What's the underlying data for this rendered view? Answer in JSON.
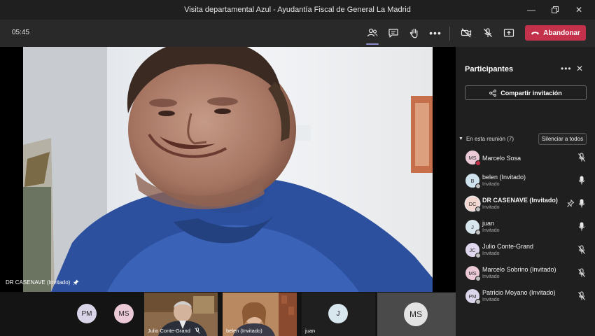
{
  "window": {
    "title": "Visita departamental Azul - Ayudantía Fiscal de General La Madrid"
  },
  "toolbar": {
    "timer": "05:45",
    "leave_label": "Abandonar"
  },
  "stage": {
    "speaker_name": "DR CASENAVE (Invitado)"
  },
  "strip": {
    "avatars": [
      {
        "initials": "PM",
        "color": "#d9d4e8"
      },
      {
        "initials": "MS",
        "color": "#ecc9d6"
      }
    ],
    "tiles": [
      {
        "label": "Julio Conte-Grand"
      },
      {
        "label": "belen (Invitado)"
      },
      {
        "label": "juan",
        "initials": "J"
      },
      {
        "initials": "MS"
      }
    ]
  },
  "panel": {
    "title": "Participantes",
    "share_label": "Compartir invitación",
    "section_label": "En esta reunión (7)",
    "mute_all_label": "Silenciar a todos",
    "participants": [
      {
        "initials": "MS",
        "name": "Marcelo Sosa",
        "role": "",
        "avatar_color": "#ecc9d6",
        "status_color": "#c4314b",
        "mic": "muted",
        "bold": false
      },
      {
        "initials": "B",
        "name": "belen (Invitado)",
        "role": "Invitado",
        "avatar_color": "#cfe3ef",
        "status_color": "#bdbdbd",
        "mic": "on",
        "bold": false
      },
      {
        "initials": "DC",
        "name": "DR CASENAVE (Invitado)",
        "role": "Invitado",
        "avatar_color": "#f3d6d0",
        "status_color": "#bdbdbd",
        "mic": "on",
        "bold": true,
        "pinned": true
      },
      {
        "initials": "J",
        "name": "juan",
        "role": "Invitado",
        "avatar_color": "#d8e6ee",
        "status_color": "#bdbdbd",
        "mic": "on",
        "bold": false
      },
      {
        "initials": "JC",
        "name": "Julio Conte-Grand",
        "role": "Invitado",
        "avatar_color": "#e0d8ef",
        "status_color": "#bdbdbd",
        "mic": "muted",
        "bold": false
      },
      {
        "initials": "MS",
        "name": "Marcelo Sobrino (Invitado)",
        "role": "Invitado",
        "avatar_color": "#ecc9d6",
        "status_color": "#bdbdbd",
        "mic": "muted",
        "bold": false
      },
      {
        "initials": "PM",
        "name": "Patricio Moyano (Invitado)",
        "role": "Invitado",
        "avatar_color": "#dcd6ec",
        "status_color": "#bdbdbd",
        "mic": "muted",
        "bold": false
      }
    ]
  }
}
